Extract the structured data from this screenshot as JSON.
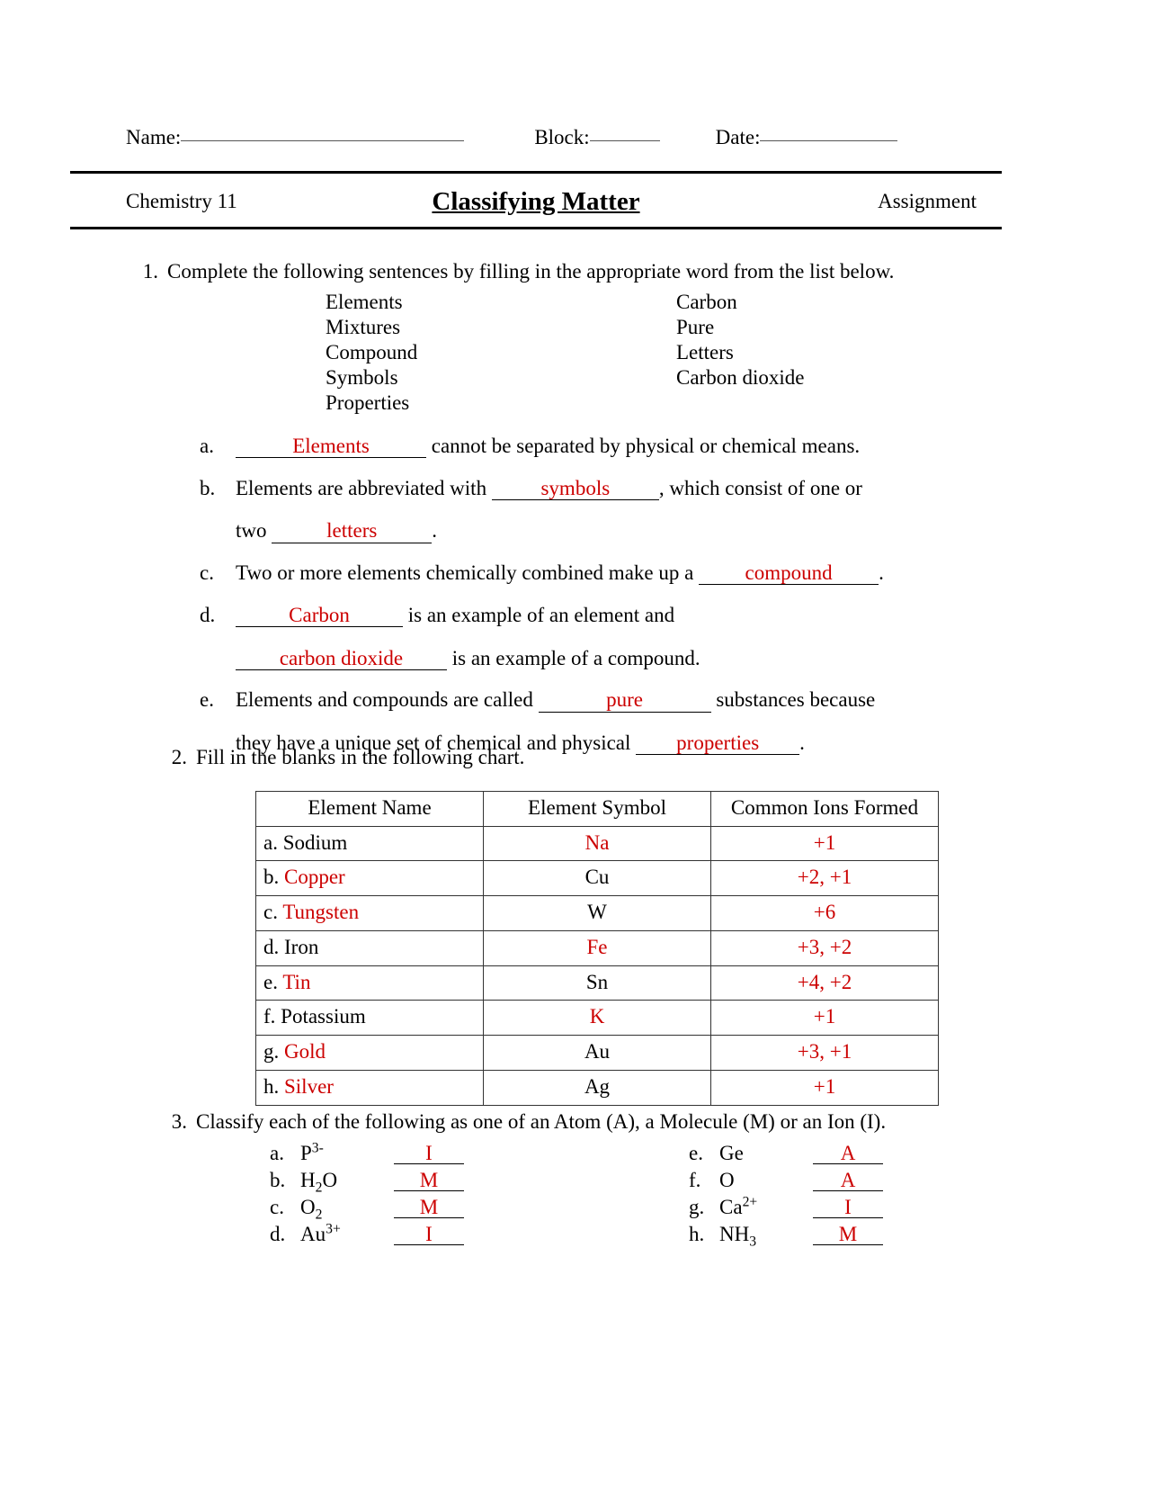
{
  "header": {
    "name_label": "Name:",
    "block_label": "Block:",
    "date_label": "Date:",
    "course": "Chemistry 11",
    "title": "Classifying Matter",
    "doc_type": "Assignment"
  },
  "colors": {
    "answer_red": "#cc0000",
    "ink_black": "#000000"
  },
  "q1": {
    "number": "1.",
    "prompt": "Complete the following sentences by filling in the appropriate word from the list below.",
    "wordlist_col1": [
      "Elements",
      "Mixtures",
      "Compound",
      "Symbols",
      "Properties"
    ],
    "wordlist_col2": [
      "Carbon",
      "Pure",
      "Letters",
      "Carbon dioxide"
    ],
    "items": [
      {
        "letter": "a.",
        "answer": "Elements",
        "after": " cannot be separated by physical or chemical means."
      },
      {
        "letter": "b.",
        "before": "Elements are abbreviated with ",
        "answer": "symbols",
        "after": ", which consist of one or",
        "line2_before": "two ",
        "line2_answer": "letters",
        "line2_after": "."
      },
      {
        "letter": "c.",
        "before": "Two or more elements chemically combined make up a ",
        "answer": "compound",
        "after": "."
      },
      {
        "letter": "d.",
        "answer": "Carbon",
        "after": " is an example of an element and",
        "line2_answer": "carbon dioxide",
        "line2_after": " is an example of a compound."
      },
      {
        "letter": "e.",
        "before": "Elements and compounds are called ",
        "answer": "pure",
        "after": " substances because",
        "line2_before": "they have a unique set of chemical and physical ",
        "line2_answer": "properties",
        "line2_after": "."
      }
    ]
  },
  "q2": {
    "number": "2.",
    "prompt": "Fill in the blanks in the following chart.",
    "columns": [
      "Element Name",
      "Element Symbol",
      "Common Ions Formed"
    ],
    "rows": [
      {
        "letter": "a.",
        "name": "Sodium",
        "name_filled": false,
        "symbol": "Na",
        "symbol_filled": true,
        "ions": "+1"
      },
      {
        "letter": "b.",
        "name": "Copper",
        "name_filled": true,
        "symbol": "Cu",
        "symbol_filled": false,
        "ions": "+2, +1"
      },
      {
        "letter": "c.",
        "name": "Tungsten",
        "name_filled": true,
        "symbol": "W",
        "symbol_filled": false,
        "ions": "+6"
      },
      {
        "letter": "d.",
        "name": "Iron",
        "name_filled": false,
        "symbol": "Fe",
        "symbol_filled": true,
        "ions": "+3, +2"
      },
      {
        "letter": "e.",
        "name": "Tin",
        "name_filled": true,
        "symbol": "Sn",
        "symbol_filled": false,
        "ions": "+4, +2"
      },
      {
        "letter": "f.",
        "name": "Potassium",
        "name_filled": false,
        "symbol": "K",
        "symbol_filled": true,
        "ions": "+1"
      },
      {
        "letter": "g.",
        "name": "Gold",
        "name_filled": true,
        "symbol": "Au",
        "symbol_filled": false,
        "ions": "+3, +1"
      },
      {
        "letter": "h.",
        "name": "Silver",
        "name_filled": true,
        "symbol": "Ag",
        "symbol_filled": false,
        "ions": "+1"
      }
    ]
  },
  "q3": {
    "number": "3.",
    "prompt": "Classify each of the following as one of an Atom (A), a Molecule (M) or an Ion (I).",
    "left": [
      {
        "letter": "a.",
        "formula_base": "P",
        "formula_sup": "3-",
        "formula_sub": "",
        "answer": "I"
      },
      {
        "letter": "b.",
        "formula_base": "H",
        "formula_sup": "",
        "formula_sub": "2",
        "formula_tail": "O",
        "answer": "M"
      },
      {
        "letter": "c.",
        "formula_base": "O",
        "formula_sup": "",
        "formula_sub": "2",
        "answer": "M"
      },
      {
        "letter": "d.",
        "formula_base": "Au",
        "formula_sup": "3+",
        "formula_sub": "",
        "answer": "I"
      }
    ],
    "right": [
      {
        "letter": "e.",
        "formula_base": "Ge",
        "formula_sup": "",
        "formula_sub": "",
        "answer": "A"
      },
      {
        "letter": "f.",
        "formula_base": "O",
        "formula_sup": "",
        "formula_sub": "",
        "answer": "A"
      },
      {
        "letter": "g.",
        "formula_base": "Ca",
        "formula_sup": "2+",
        "formula_sub": "",
        "answer": "I"
      },
      {
        "letter": "h.",
        "formula_base": "NH",
        "formula_sup": "",
        "formula_sub": "3",
        "answer": "M"
      }
    ]
  }
}
